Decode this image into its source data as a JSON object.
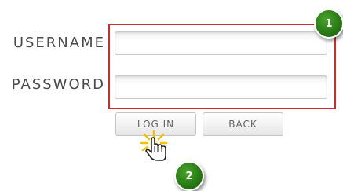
{
  "form": {
    "username_label": "USERNAME",
    "password_label": "PASSWORD",
    "username_value": "",
    "password_value": ""
  },
  "buttons": {
    "login_label": "LOG IN",
    "back_label": "BACK"
  },
  "callouts": {
    "badge_1": "1",
    "badge_2": "2"
  },
  "icons": {
    "cursor": "hand-pointer-icon"
  },
  "colors": {
    "highlight": "#d9262b",
    "badge": "#2e8a1a"
  }
}
